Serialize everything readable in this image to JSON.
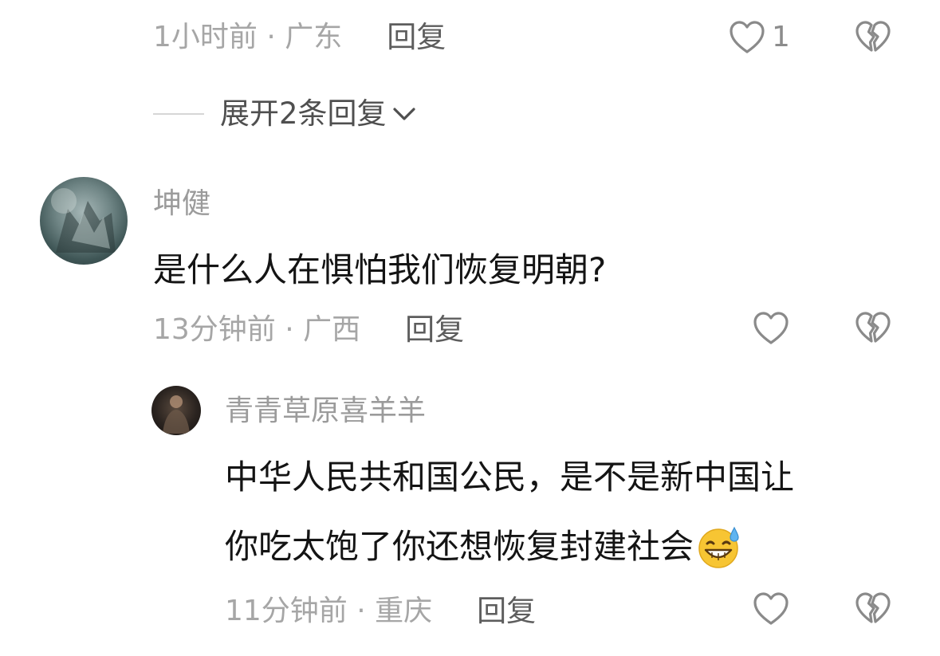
{
  "comment_prev": {
    "meta": "1小时前 · 广东",
    "reply_label": "回复",
    "like_count": "1"
  },
  "expand": {
    "label": "展开2条回复"
  },
  "comment_1": {
    "username": "坤健",
    "text": "是什么人在惧怕我们恢复明朝?",
    "meta": "13分钟前 · 广西",
    "reply_label": "回复"
  },
  "reply_1": {
    "username": "青青草原喜羊羊",
    "text_line1": "中华人民共和国公民，是不是新中国让",
    "text_line2": "你吃太饱了你还想恢复封建社会",
    "emoji": "😅",
    "meta": "11分钟前 · 重庆",
    "reply_label": "回复"
  },
  "icons": {
    "like": "heart-outline-icon",
    "dislike": "broken-heart-icon",
    "expand": "chevron-down-icon"
  },
  "colors": {
    "meta_text": "#a6a6a6",
    "comment_text": "#141414",
    "icon_stroke": "#8a8a8a"
  }
}
